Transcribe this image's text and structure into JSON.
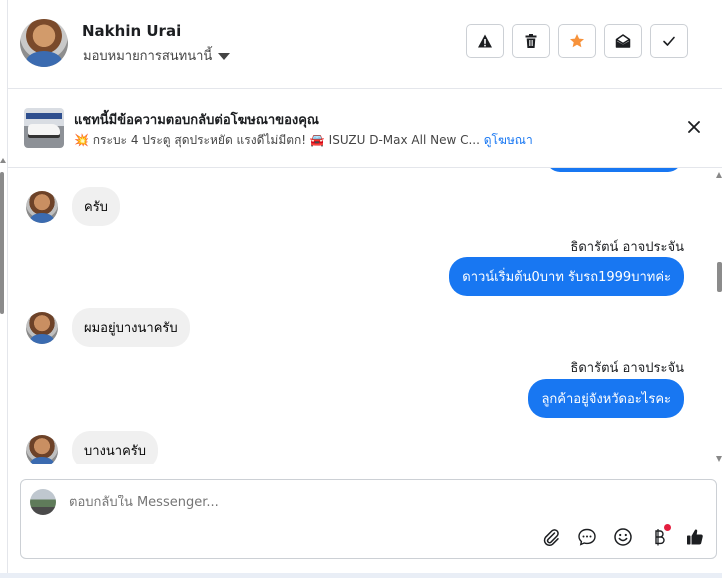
{
  "header": {
    "contact_name": "Nakhin Urai",
    "assign_label": "มอบหมายการสนทนานี้",
    "actions": [
      {
        "icon": "warning-icon"
      },
      {
        "icon": "trash-icon"
      },
      {
        "icon": "star-icon",
        "color": "#f7923b"
      },
      {
        "icon": "envelope-open-icon"
      },
      {
        "icon": "checkmark-icon"
      }
    ]
  },
  "banner": {
    "title": "แชทนี้มีข้อความตอบกลับต่อโฆษณาของคุณ",
    "ad_text": "กระบะ 4 ประตู สุดประหยัด แรงดีไม่มีตก! 🚘 ISUZU D-Max All New C...",
    "link_label": "ดูโฆษณา"
  },
  "messages": [
    {
      "direction": "in",
      "text": "ครับ"
    },
    {
      "direction": "out",
      "sender": "ธิดารัตน์ อาจประจัน",
      "text": "ดาวน์เริ่มต้น0บาท รับรถ1999บาทค่ะ"
    },
    {
      "direction": "in",
      "text": "ผมอยู่บางนาครับ"
    },
    {
      "direction": "out",
      "sender": "ธิดารัตน์ อาจประจัน",
      "text": "ลูกค้าอยู่จังหวัดอะไรคะ"
    },
    {
      "direction": "in",
      "text": "บางนาครับ"
    }
  ],
  "composer": {
    "placeholder": "ตอบกลับใน Messenger...",
    "tools": [
      "paperclip-icon",
      "chat-bubble-icon",
      "emoji-icon",
      "baht-icon",
      "thumbs-up-icon"
    ]
  },
  "colors": {
    "accent": "#1877f2",
    "incoming_bubble": "#f0f0f0",
    "star": "#f7923b"
  }
}
